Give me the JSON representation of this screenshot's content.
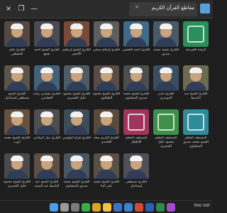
{
  "window": {
    "title": "مقاطع القرآن الكريم",
    "close_glyph": "×",
    "minimize_glyph": "—",
    "restore_glyph": "❐",
    "tab_close_glyph": "×",
    "accent_color": "#5aa0d8"
  },
  "tiles": [
    {
      "label": "الرقية الشرعية",
      "icon": "ruqyah-logo",
      "color": "#2a8f5a",
      "row": 0,
      "col": 0
    },
    {
      "label": "القارئ محمد محمد صديق",
      "icon": "reciter-portrait",
      "color": "#4a5968",
      "row": 0,
      "col": 1
    },
    {
      "label": "القارئ أحمد العجمي",
      "icon": "reciter-portrait",
      "color": "#3f6a88",
      "row": 0,
      "col": 2
    },
    {
      "label": "القارئ إسلام صبحي",
      "icon": "reciter-portrait",
      "color": "#5d5d5d",
      "row": 0,
      "col": 3
    },
    {
      "label": "القارئ الشيخ إبراهيم الأخضر",
      "icon": "reciter-portrait",
      "color": "#7a4a38",
      "row": 0,
      "col": 4
    },
    {
      "label": "القارئ الشيخ أحمد نعينع",
      "icon": "reciter-portrait",
      "color": "#4b4b55",
      "row": 0,
      "col": 5
    },
    {
      "label": "القارئ ماهر المعيقلي",
      "icon": "reciter-portrait",
      "color": "#54483f",
      "row": 0,
      "col": 6
    },
    {
      "label": "القارئ الشيخ عبد الباسط",
      "icon": "reciter-portrait",
      "color": "#6d6a52",
      "row": 1,
      "col": 0
    },
    {
      "label": "القارئ ياسر الدوسري",
      "icon": "reciter-portrait",
      "color": "#3b4d60",
      "row": 1,
      "col": 1
    },
    {
      "label": "القارئ الشيخ محمد صديق المنشاوي",
      "icon": "reciter-portrait",
      "color": "#4d4d4d",
      "row": 1,
      "col": 2
    },
    {
      "label": "القارئ الشيخ محمود الطبلاوي",
      "icon": "reciter-portrait",
      "color": "#5a4b44",
      "row": 1,
      "col": 3
    },
    {
      "label": "القارئ الشيخ محمود خليل الحصري",
      "icon": "reciter-portrait",
      "color": "#4f5a63",
      "row": 1,
      "col": 4
    },
    {
      "label": "القارئ مشاري راشد العفاسي",
      "icon": "reciter-portrait",
      "color": "#45617a",
      "row": 1,
      "col": 5
    },
    {
      "label": "القارئ الشيخ مصطفى إسماعيل",
      "icon": "reciter-portrait",
      "color": "#5b5448",
      "row": 1,
      "col": 6
    },
    {
      "label": "المصحف المعلم الشيخ محمد صديق المنشاوي",
      "icon": "mushaf-cover",
      "color": "#2f8a9a",
      "row": 2,
      "col": 0
    },
    {
      "label": "المصحف المعلم محمود خليل الحصري",
      "icon": "mushaf-cover",
      "color": "#3d8f4a",
      "row": 2,
      "col": 1
    },
    {
      "label": "المصحف المعلم للأطفال",
      "icon": "mushaf-cover",
      "color": "#a0345a",
      "row": 2,
      "col": 2
    },
    {
      "label": "القارئ الكريم سعد الغامدي",
      "icon": "reciter-portrait",
      "color": "#5a4a3b",
      "row": 2,
      "col": 3
    },
    {
      "label": "القارئ هزاع البلوشي",
      "icon": "reciter-portrait",
      "color": "#3e4b58",
      "row": 2,
      "col": 4
    },
    {
      "label": "القارئ نبيل الرفاعي",
      "icon": "reciter-portrait",
      "color": "#4e4e4e",
      "row": 2,
      "col": 5
    },
    {
      "label": "القارئ الشيخ محمد أيوب",
      "icon": "reciter-portrait",
      "color": "#67503f",
      "row": 2,
      "col": 6
    },
    {
      "label": "القارئ مصطفى إسماعيل",
      "icon": "reciter-portrait",
      "color": "#4f4f58",
      "row": 3,
      "col": 2
    },
    {
      "label": "القارئ الشيخ محمد علي البنا",
      "icon": "reciter-portrait",
      "color": "#5a4f45",
      "row": 3,
      "col": 3
    },
    {
      "label": "القارئ الشيخ محمد صديق المنشاوي",
      "icon": "reciter-portrait",
      "color": "#4b5560",
      "row": 3,
      "col": 4
    },
    {
      "label": "القارئ الشيخ عبد الباسط عبد الصمد",
      "icon": "reciter-portrait",
      "color": "#5e4e44",
      "row": 3,
      "col": 5
    },
    {
      "label": "القارئ الشيخ محمود خليل الحصري",
      "icon": "reciter-portrait",
      "color": "#4a4a4a",
      "row": 3,
      "col": 6
    }
  ],
  "taskbar": {
    "icons": [
      "start-icon",
      "search-icon",
      "taskview-icon",
      "whatsapp-icon",
      "chrome-icon",
      "files-icon",
      "store-icon",
      "mail-icon",
      "video-icon",
      "word-icon",
      "excel-icon",
      "media-icon"
    ],
    "time": "SNP",
    "lang": "ENG"
  }
}
